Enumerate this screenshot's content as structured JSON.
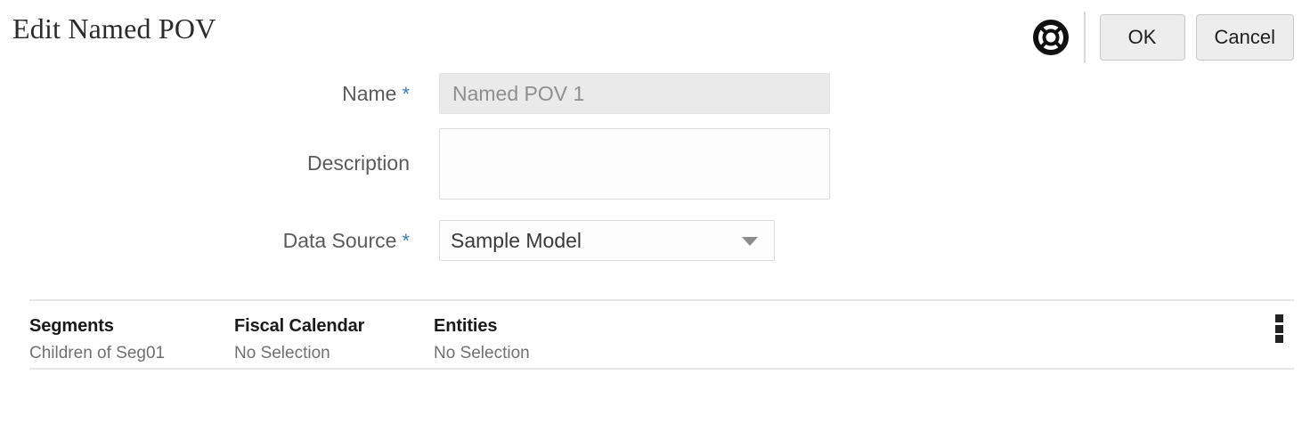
{
  "dialog": {
    "title": "Edit Named POV"
  },
  "header": {
    "help_icon": "help-ring-icon",
    "ok_label": "OK",
    "cancel_label": "Cancel"
  },
  "form": {
    "name": {
      "label": "Name",
      "required_marker": "*",
      "value": "Named POV 1",
      "placeholder": "Named POV 1"
    },
    "description": {
      "label": "Description",
      "value": "",
      "placeholder": ""
    },
    "data_source": {
      "label": "Data Source",
      "required_marker": "*",
      "selected": "Sample Model",
      "options": [
        "Sample Model"
      ]
    }
  },
  "segment_table": {
    "menu_icon": "kebab-menu-icon",
    "columns": [
      {
        "header": "Segments",
        "value": "Children of Seg01"
      },
      {
        "header": "Fiscal Calendar",
        "value": "No Selection"
      },
      {
        "header": "Entities",
        "value": "No Selection"
      }
    ]
  },
  "colors": {
    "required_asterisk": "#3c7cb4",
    "button_face": "#ededed",
    "disabled_field": "#eaeaea",
    "divider": "#e6e6e6"
  }
}
